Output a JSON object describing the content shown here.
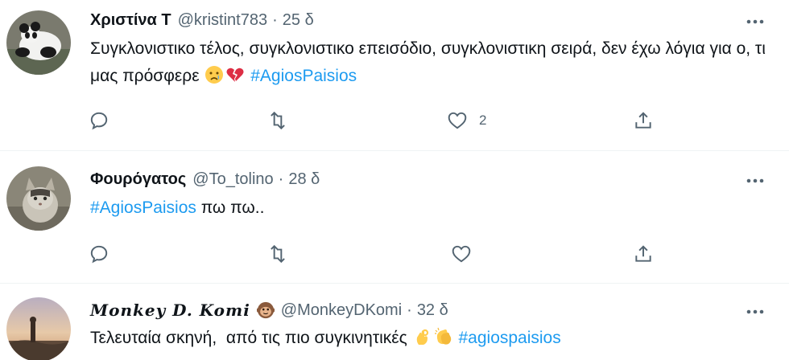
{
  "tweets": [
    {
      "name": "Χριστίνα Τ",
      "handle": "@kristint783",
      "dot": "·",
      "time": "25 δ",
      "text_plain": "Συγκλονιστικο τέλος, συγκλονιστικο επεισόδιο, συγκλονιστικη σειρά, δεν έχω λόγια για ο, τι μας πρόσφερε",
      "emojis": [
        "crying-face-emoji",
        "broken-heart-emoji"
      ],
      "hashtag": "#AgiosPaisios",
      "like_count": "2",
      "avatar": "panda"
    },
    {
      "name": "Φουρόγατος",
      "handle": "@To_tolino",
      "dot": "·",
      "time": "28 δ",
      "hashtag": "#AgiosPaisios",
      "text_after": " πω πω..",
      "avatar": "cat"
    },
    {
      "name": "Monkey D. Komi",
      "handle": "@MonkeyDKomi",
      "dot": "·",
      "time": "32 δ",
      "text_plain": "Τελευταία σκηνή,  από τις πιο συγκινητικές",
      "emojis": [
        "ok-hand-emoji",
        "clapping-hands-emoji"
      ],
      "hashtag": "#agiospaisios",
      "avatar": "sunset"
    }
  ],
  "colors": {
    "accent": "#1d9bf0",
    "secondary_text": "#536471",
    "divider": "#eff3f4",
    "primary_text": "#0f1419"
  },
  "icons": [
    "reply-icon",
    "retweet-icon",
    "like-icon",
    "share-icon",
    "more-icon"
  ]
}
